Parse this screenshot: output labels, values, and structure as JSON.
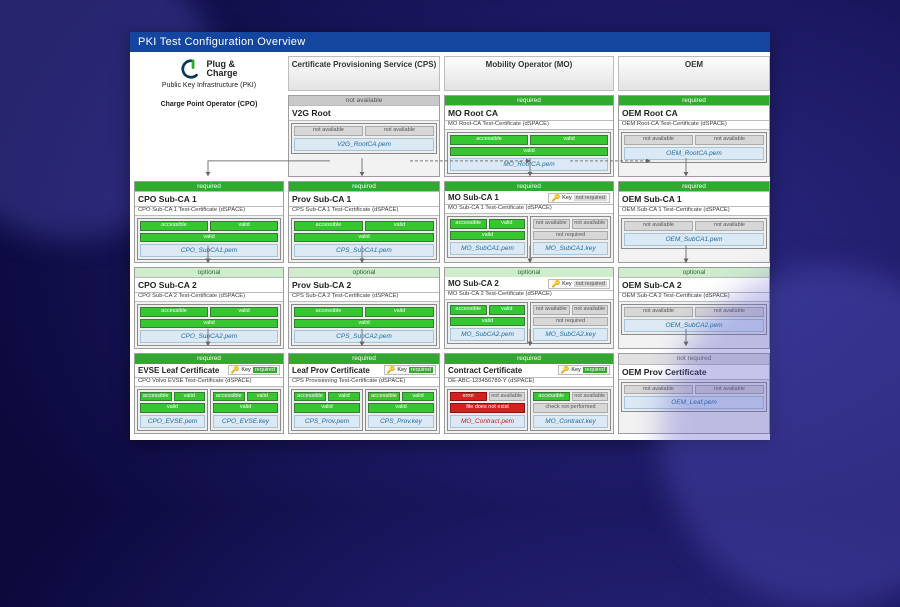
{
  "title": "PKI Test Configuration Overview",
  "brand": {
    "line1": "Plug &",
    "line2": "Charge",
    "sub": "Public Key Infrastructure (PKI)"
  },
  "cols": {
    "cps": "Certificate Provisioning Service (CPS)",
    "mo": "Mobility Operator (MO)",
    "oem": "OEM",
    "cpo": "Charge Point Operator (CPO)"
  },
  "req": {
    "required": "required",
    "optional": "optional",
    "na": "not available",
    "nr": "not required"
  },
  "pill": {
    "acc": "accessible",
    "valid": "valid",
    "nav": "not available",
    "err": "error",
    "fdne": "file does not exist",
    "cnp": "check not performed"
  },
  "key": {
    "label": "Key",
    "req": "required",
    "nr": "not required"
  },
  "n": {
    "v2g": {
      "name": "V2G Root",
      "file": "V2G_RootCA.pem"
    },
    "mor": {
      "name": "MO Root CA",
      "desc": "MO Root-CA Test-Certificate (dSPACE)",
      "file": "MO_RootCA.pem"
    },
    "oer": {
      "name": "OEM Root CA",
      "desc": "OEM Root-CA Test-Certificate (dSPACE)",
      "file": "OEM_RootCA.pem"
    },
    "cpo1": {
      "name": "CPO Sub-CA 1",
      "desc": "CPO Sub-CA 1 Test-Certificate (dSPACE)",
      "file": "CPO_SubCA1.pem"
    },
    "cps1": {
      "name": "Prov Sub-CA 1",
      "desc": "CPS Sub-CA 1 Test-Certificate (dSPACE)",
      "file": "CPS_SubCA1.pem"
    },
    "mo1": {
      "name": "MO Sub-CA 1",
      "desc": "MO Sub-CA 1 Test-Certificate (dSPACE)",
      "file": "MO_SubCA1.pem",
      "key": "MO_SubCA1.key"
    },
    "oe1": {
      "name": "OEM Sub-CA 1",
      "desc": "OEM Sub-CA 1 Test-Certificate (dSPACE)",
      "file": "OEM_SubCA1.pem"
    },
    "cpo2": {
      "name": "CPO Sub-CA 2",
      "desc": "CPO Sub-CA 2 Test-Certificate (dSPACE)",
      "file": "CPO_SubCA2.pem"
    },
    "cps2": {
      "name": "Prov Sub-CA 2",
      "desc": "CPS Sub-CA 2 Test-Certificate (dSPACE)",
      "file": "CPS_SubCA2.pem"
    },
    "mo2": {
      "name": "MO Sub-CA 2",
      "desc": "MO Sub-CA 2 Test-Certificate (dSPACE)",
      "file": "MO_SubCA2.pem",
      "key": "MO_SubCA2.key"
    },
    "oe2": {
      "name": "OEM Sub-CA 2",
      "desc": "OEM Sub-CA 2 Test-Certificate (dSPACE)",
      "file": "OEM_SubCA2.pem"
    },
    "evse": {
      "name": "EVSE Leaf Certificate",
      "desc": "CPO Volvo EVSE Test-Certificate (dSPACE)",
      "file": "CPO_EVSE.pem",
      "key": "CPO_EVSE.key"
    },
    "leaf": {
      "name": "Leaf Prov Certificate",
      "desc": "CPS Provisioning Test-Certificate (dSPACE)",
      "file": "CPS_Prov.pem",
      "key": "CPS_Prov.key"
    },
    "con": {
      "name": "Contract Certificate",
      "desc": "DE-ABC-123456789-Y (dSPACE)",
      "file": "MO_Contract.pem",
      "key": "MO_Contract.key"
    },
    "oep": {
      "name": "OEM Prov Certificate",
      "file": "OEM_Leaf.pem"
    }
  }
}
